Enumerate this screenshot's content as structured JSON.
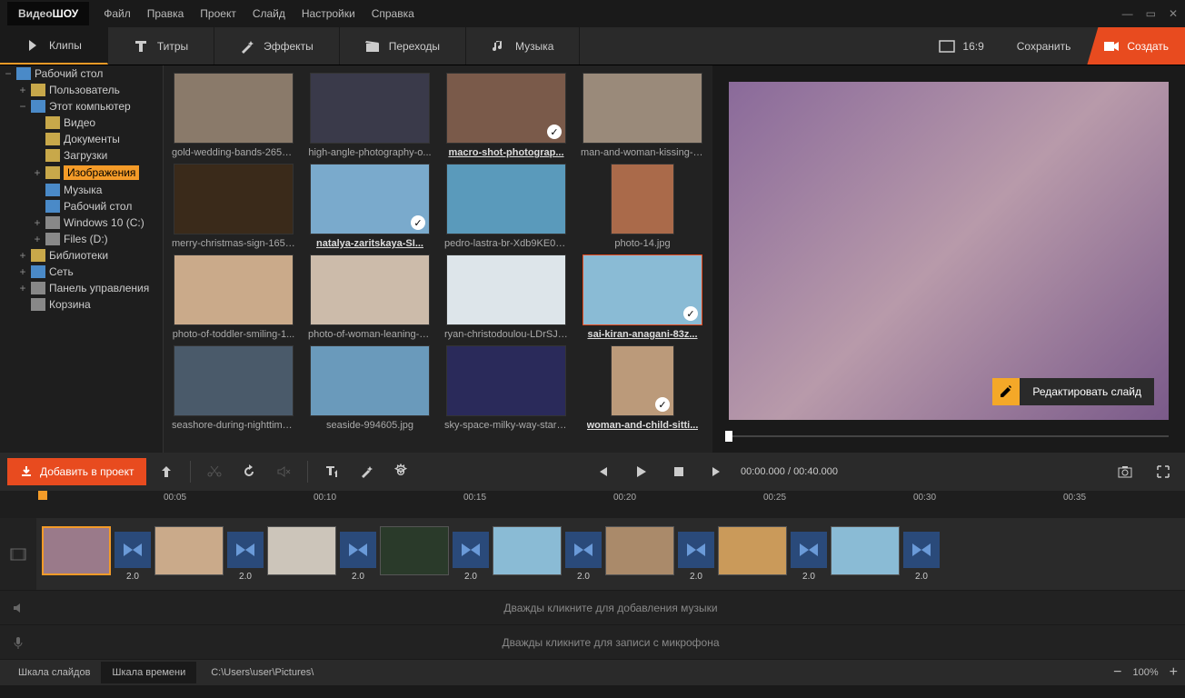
{
  "app": {
    "logo1": "Видео",
    "logo2": "ШОУ"
  },
  "menu": [
    "Файл",
    "Правка",
    "Проект",
    "Слайд",
    "Настройки",
    "Справка"
  ],
  "tabs": [
    {
      "label": "Клипы"
    },
    {
      "label": "Титры"
    },
    {
      "label": "Эффекты"
    },
    {
      "label": "Переходы"
    },
    {
      "label": "Музыка"
    }
  ],
  "aspect": "16:9",
  "btn_save": "Сохранить",
  "btn_create": "Создать",
  "tree": [
    {
      "label": "Рабочий стол",
      "indent": 0,
      "exp": "−",
      "type": "desktop"
    },
    {
      "label": "Пользователь",
      "indent": 1,
      "exp": "+",
      "type": "user"
    },
    {
      "label": "Этот компьютер",
      "indent": 1,
      "exp": "−",
      "type": "pc"
    },
    {
      "label": "Видео",
      "indent": 2,
      "exp": "",
      "type": "folder"
    },
    {
      "label": "Документы",
      "indent": 2,
      "exp": "",
      "type": "folder"
    },
    {
      "label": "Загрузки",
      "indent": 2,
      "exp": "",
      "type": "folder"
    },
    {
      "label": "Изображения",
      "indent": 2,
      "exp": "+",
      "type": "folder",
      "selected": true
    },
    {
      "label": "Музыка",
      "indent": 2,
      "exp": "",
      "type": "music"
    },
    {
      "label": "Рабочий стол",
      "indent": 2,
      "exp": "",
      "type": "desktop"
    },
    {
      "label": "Windows 10 (C:)",
      "indent": 2,
      "exp": "+",
      "type": "drive"
    },
    {
      "label": "Files (D:)",
      "indent": 2,
      "exp": "+",
      "type": "drive"
    },
    {
      "label": "Библиотеки",
      "indent": 1,
      "exp": "+",
      "type": "lib"
    },
    {
      "label": "Сеть",
      "indent": 1,
      "exp": "+",
      "type": "net"
    },
    {
      "label": "Панель управления",
      "indent": 1,
      "exp": "+",
      "type": "cp"
    },
    {
      "label": "Корзина",
      "indent": 1,
      "exp": "",
      "type": "bin"
    }
  ],
  "thumbs": [
    [
      {
        "cap": "gold-wedding-bands-2657...",
        "bg": "#8a7a6a"
      },
      {
        "cap": "high-angle-photography-o...",
        "bg": "#3a3a4a"
      },
      {
        "cap": "macro-shot-photograp...",
        "bg": "#7a5a4a",
        "check": true,
        "bold": true
      },
      {
        "cap": "man-and-woman-kissing-2...",
        "bg": "#9a8a7a"
      }
    ],
    [
      {
        "cap": "merry-christmas-sign-1656...",
        "bg": "#3a2a1a"
      },
      {
        "cap": "natalya-zaritskaya-SI...",
        "bg": "#7aaacc",
        "check": true,
        "bold": true
      },
      {
        "cap": "pedro-lastra-br-Xdb9KE0Q...",
        "bg": "#5a9abb"
      },
      {
        "cap": "photo-14.jpg",
        "bg": "#aa6a4a",
        "narrow": true
      }
    ],
    [
      {
        "cap": "photo-of-toddler-smiling-1...",
        "bg": "#caaa8a"
      },
      {
        "cap": "photo-of-woman-leaning-o...",
        "bg": "#ccbbaa"
      },
      {
        "cap": "ryan-christodoulou-LDrSJ3...",
        "bg": "#dde5ea"
      },
      {
        "cap": "sai-kiran-anagani-83z...",
        "bg": "#8abbd5",
        "check": true,
        "selected": true,
        "bold": true
      }
    ],
    [
      {
        "cap": "seashore-during-nighttime...",
        "bg": "#4a5a6a"
      },
      {
        "cap": "seaside-994605.jpg",
        "bg": "#6a9abb"
      },
      {
        "cap": "sky-space-milky-way-stars...",
        "bg": "#2a2a5a"
      },
      {
        "cap": "woman-and-child-sitti...",
        "bg": "#bb9a7a",
        "check": true,
        "narrow": true,
        "bold": true
      }
    ]
  ],
  "edit_slide": "Редактировать слайд",
  "btn_add_project": "Добавить в проект",
  "time_current": "00:00.000",
  "time_total": "00:40.000",
  "ruler_marks": [
    "00:05",
    "00:10",
    "00:15",
    "00:20",
    "00:25",
    "00:30",
    "00:35"
  ],
  "timeline_clips": [
    {
      "dur": "",
      "bg": "#9a7a8a",
      "sel": true
    },
    {
      "dur": "2.0",
      "trans": true
    },
    {
      "dur": "",
      "bg": "#caaa8a"
    },
    {
      "dur": "2.0",
      "trans": true
    },
    {
      "dur": "",
      "bg": "#ccc5ba"
    },
    {
      "dur": "2.0",
      "trans": true
    },
    {
      "dur": "",
      "bg": "#2a3a2a"
    },
    {
      "dur": "2.0",
      "trans": true
    },
    {
      "dur": "",
      "bg": "#8abbd5"
    },
    {
      "dur": "2.0",
      "trans": true
    },
    {
      "dur": "",
      "bg": "#aa8a6a"
    },
    {
      "dur": "2.0",
      "trans": true
    },
    {
      "dur": "",
      "bg": "#ca9a5a"
    },
    {
      "dur": "2.0",
      "trans": true
    },
    {
      "dur": "",
      "bg": "#8abbd5"
    },
    {
      "dur": "2.0",
      "trans": true
    }
  ],
  "audio_hint": "Дважды кликните для добавления музыки",
  "mic_hint": "Дважды кликните для записи с микрофона",
  "status_tabs": [
    "Шкала слайдов",
    "Шкала времени"
  ],
  "status_path": "C:\\Users\\user\\Pictures\\",
  "zoom": "100%"
}
